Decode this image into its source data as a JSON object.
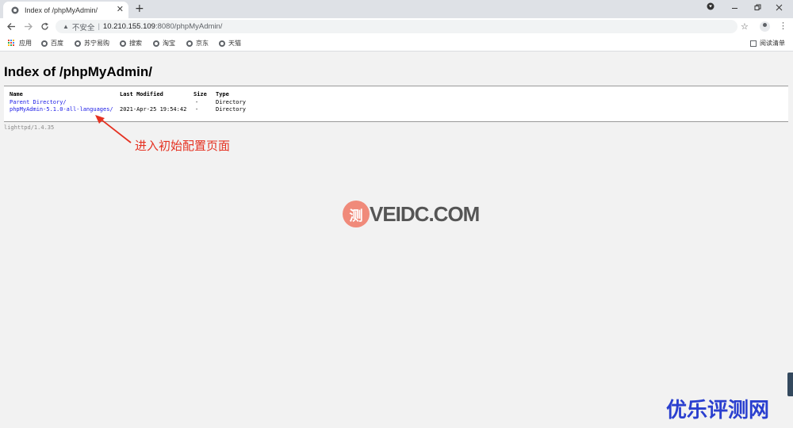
{
  "browser": {
    "tab_title": "Index of /phpMyAdmin/",
    "tab_close": "✕",
    "new_tab": "+",
    "address": {
      "security_label": "不安全",
      "separator": "|",
      "host": "10.210.155.109",
      "rest": ":8080/phpMyAdmin/"
    },
    "bookmarks": [
      "应用",
      "百度",
      "苏宁易购",
      "搜索",
      "淘宝",
      "京东",
      "天猫"
    ],
    "reading_list": "阅读清单",
    "icons": {
      "back": "back-arrow-icon",
      "forward": "forward-arrow-icon",
      "reload": "reload-icon",
      "warning": "warning-icon",
      "star": "star-icon",
      "profile": "profile-icon",
      "menu": "kebab-menu-icon"
    }
  },
  "page": {
    "title": "Index of /phpMyAdmin/",
    "columns": [
      "Name",
      "Last Modified",
      "Size",
      "Type"
    ],
    "rows": [
      {
        "name": "Parent Directory/",
        "modified": "",
        "size": "-",
        "type": "Directory"
      },
      {
        "name": "phpMyAdmin-5.1.0-all-languages/",
        "modified": "2021-Apr-25 19:54:42",
        "size": "-",
        "type": "Directory"
      }
    ],
    "footer": "lighttpd/1.4.35"
  },
  "annotation": {
    "text": "进入初始配置页面",
    "color": "#e53222"
  },
  "watermark": {
    "logo_char": "测",
    "text": "VEIDC.COM",
    "brand": "优乐评测网",
    "brand_color": "#2a3fcf"
  }
}
